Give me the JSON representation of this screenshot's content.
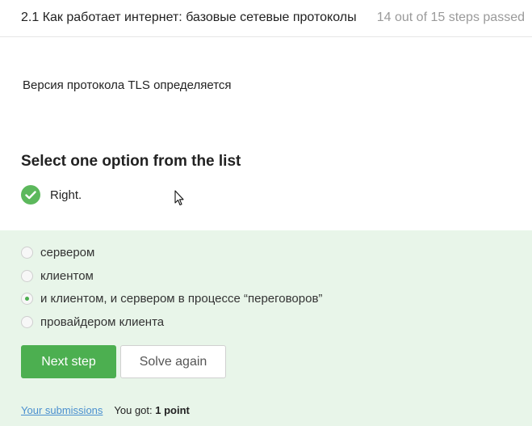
{
  "header": {
    "lesson_title": "2.1 Как работает интернет: базовые сетевые протоколы",
    "progress": "14 out of 15 steps passed"
  },
  "question": {
    "text": "Версия протокола TLS определяется"
  },
  "quiz": {
    "section_title": "Select one option from the list",
    "result_text": "Right.",
    "options": [
      {
        "label": "сервером",
        "selected": false
      },
      {
        "label": "клиентом",
        "selected": false
      },
      {
        "label": "и клиентом, и сервером в процессе “переговоров”",
        "selected": true
      },
      {
        "label": "провайдером клиента",
        "selected": false
      }
    ]
  },
  "actions": {
    "next_label": "Next step",
    "solve_again_label": "Solve again"
  },
  "footer": {
    "submissions_link": "Your submissions",
    "score_prefix": "You got:",
    "score_value": "1 point"
  },
  "colors": {
    "accent": "#4caf50",
    "panel_bg": "#e8f5e9",
    "link": "#4a8fcf",
    "muted": "#9a9a9a"
  },
  "icons": {
    "result_icon": "check-circle-icon",
    "cursor": "mouse-cursor-icon"
  }
}
